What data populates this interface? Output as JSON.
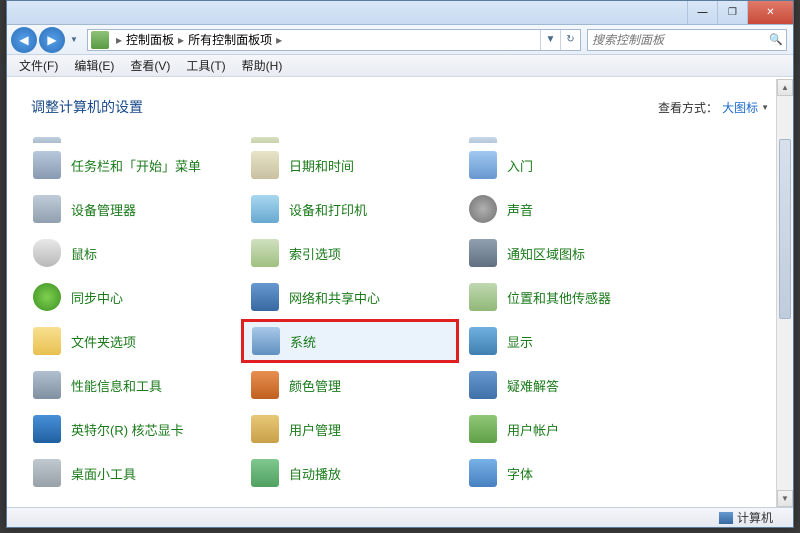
{
  "titlebar": {
    "min": "—",
    "max": "❐",
    "close": "✕"
  },
  "nav": {
    "back": "◀",
    "forward": "▶",
    "dropdown": "▼",
    "breadcrumb": {
      "root": "控制面板",
      "sub": "所有控制面板项",
      "sep": "▸"
    },
    "refresh": "↻"
  },
  "search": {
    "placeholder": "搜索控制面板",
    "icon": "🔍"
  },
  "menu": {
    "file": "文件(F)",
    "edit": "编辑(E)",
    "view": "查看(V)",
    "tools": "工具(T)",
    "help": "帮助(H)"
  },
  "content": {
    "heading": "调整计算机的设置",
    "viewmode_label": "查看方式：",
    "viewmode_value": "大图标",
    "viewmode_drop": "▼"
  },
  "items": {
    "clipped": {
      "c1": "",
      "c2": "",
      "c3": ""
    },
    "r1": {
      "c1": "任务栏和「开始」菜单",
      "c2": "日期和时间",
      "c3": "入门"
    },
    "r2": {
      "c1": "设备管理器",
      "c2": "设备和打印机",
      "c3": "声音"
    },
    "r3": {
      "c1": "鼠标",
      "c2": "索引选项",
      "c3": "通知区域图标"
    },
    "r4": {
      "c1": "同步中心",
      "c2": "网络和共享中心",
      "c3": "位置和其他传感器"
    },
    "r5": {
      "c1": "文件夹选项",
      "c2": "系统",
      "c3": "显示"
    },
    "r6": {
      "c1": "性能信息和工具",
      "c2": "颜色管理",
      "c3": "疑难解答"
    },
    "r7": {
      "c1": "英特尔(R) 核芯显卡",
      "c2": "用户管理",
      "c3": "用户帐户"
    },
    "r8": {
      "c1": "桌面小工具",
      "c2": "自动播放",
      "c3": "字体"
    }
  },
  "status": {
    "label": "计算机"
  },
  "scroll": {
    "up": "▲",
    "down": "▼"
  }
}
